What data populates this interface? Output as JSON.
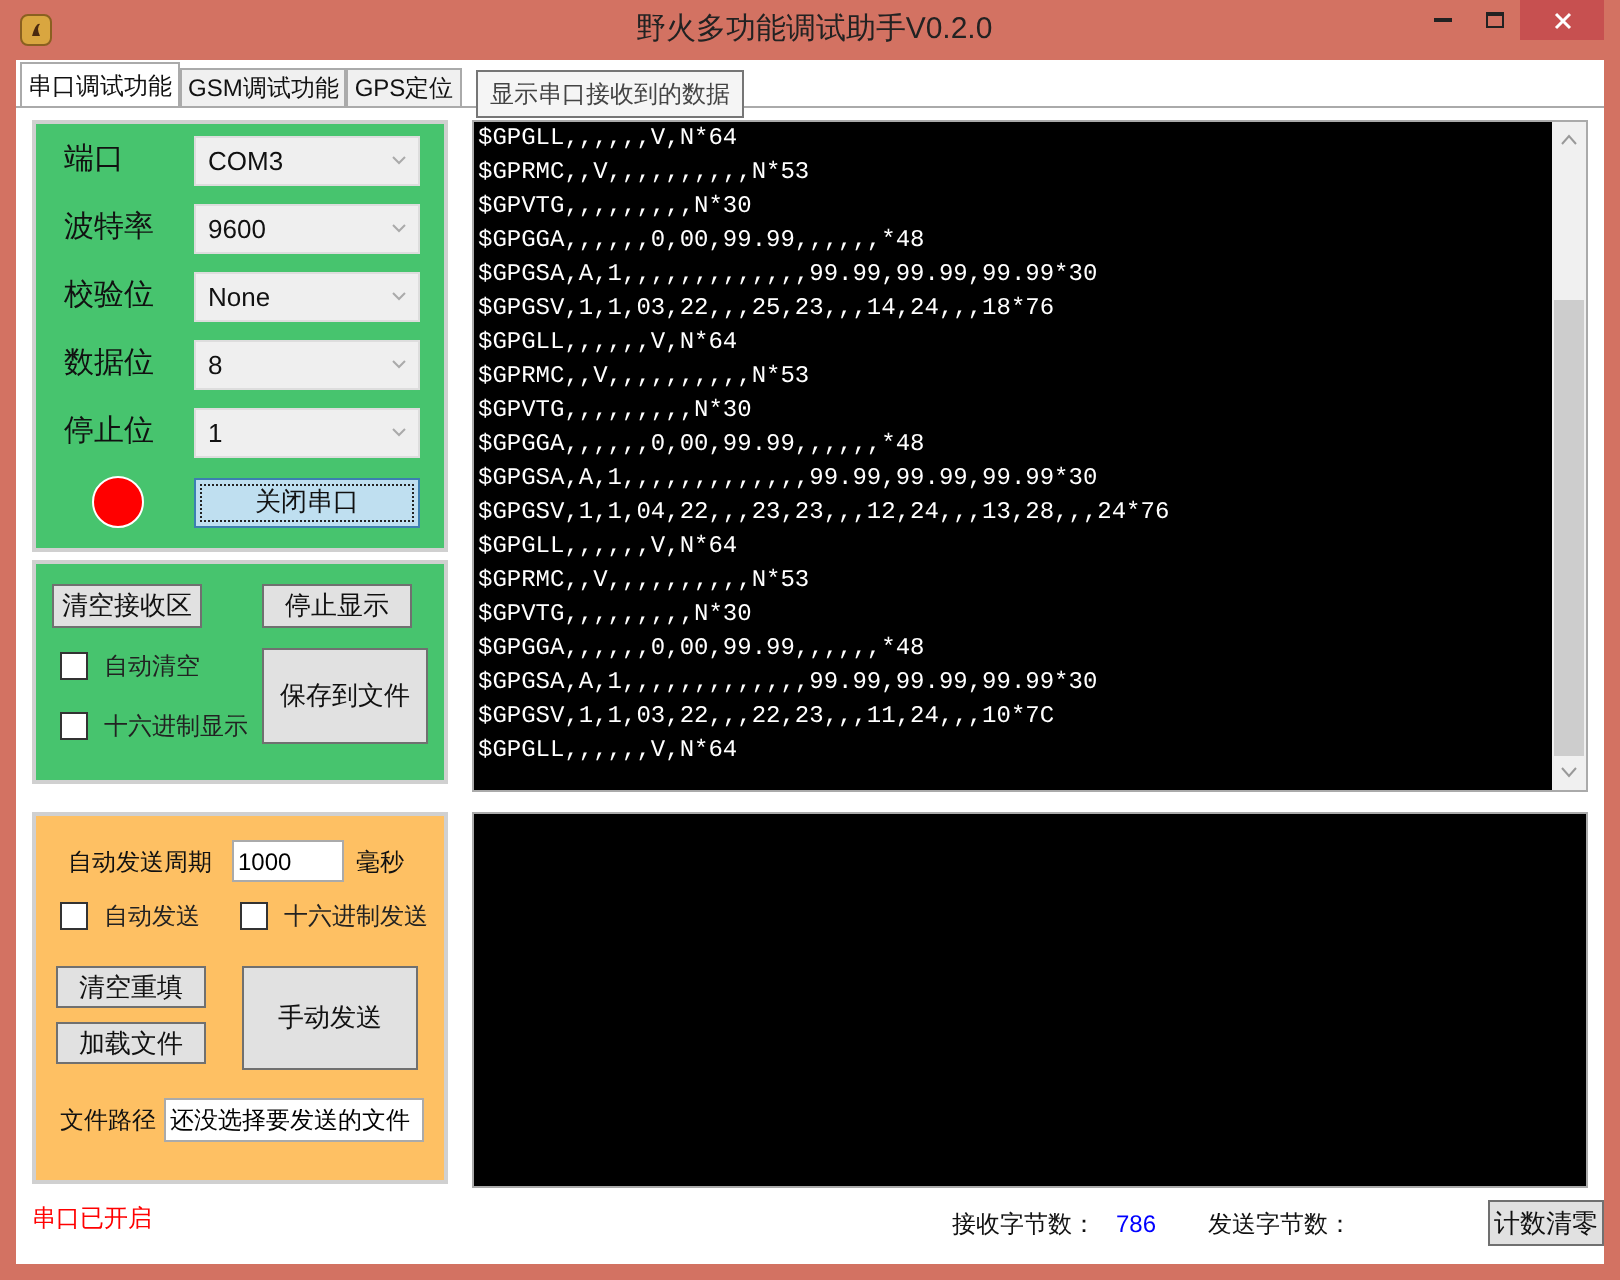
{
  "window": {
    "title": "野火多功能调试助手V0.2.0"
  },
  "tabs": [
    {
      "label": "串口调试功能",
      "selected": true
    },
    {
      "label": "GSM调试功能",
      "selected": false
    },
    {
      "label": "GPS定位",
      "selected": false
    }
  ],
  "tooltip": "显示串口接收到的数据",
  "serial_settings": [
    {
      "label": "端口",
      "value": "COM3"
    },
    {
      "label": "波特率",
      "value": "9600"
    },
    {
      "label": "校验位",
      "value": "None"
    },
    {
      "label": "数据位",
      "value": "8"
    },
    {
      "label": "停止位",
      "value": "1"
    }
  ],
  "port_indicator": {
    "color": "#ff0000"
  },
  "toggle_port_button": "关闭串口",
  "receive_controls": {
    "clear_button": "清空接收区",
    "stop_button": "停止显示",
    "save_button": "保存到文件",
    "checkboxes": [
      {
        "label": "自动清空",
        "checked": false
      },
      {
        "label": "十六进制显示",
        "checked": false
      }
    ]
  },
  "receive_lines": [
    "$GPGLL,,,,,,V,N*64",
    "$GPRMC,,V,,,,,,,,,,N*53",
    "$GPVTG,,,,,,,,,N*30",
    "$GPGGA,,,,,,0,00,99.99,,,,,,*48",
    "$GPGSA,A,1,,,,,,,,,,,,,99.99,99.99,99.99*30",
    "$GPGSV,1,1,03,22,,,25,23,,,14,24,,,18*76",
    "$GPGLL,,,,,,V,N*64",
    "$GPRMC,,V,,,,,,,,,,N*53",
    "$GPVTG,,,,,,,,,N*30",
    "$GPGGA,,,,,,0,00,99.99,,,,,,*48",
    "$GPGSA,A,1,,,,,,,,,,,,,99.99,99.99,99.99*30",
    "$GPGSV,1,1,04,22,,,23,23,,,12,24,,,13,28,,,24*76",
    "$GPGLL,,,,,,V,N*64",
    "$GPRMC,,V,,,,,,,,,,N*53",
    "$GPVTG,,,,,,,,,N*30",
    "$GPGGA,,,,,,0,00,99.99,,,,,,*48",
    "$GPGSA,A,1,,,,,,,,,,,,,99.99,99.99,99.99*30",
    "$GPGSV,1,1,03,22,,,22,23,,,11,24,,,10*7C",
    "$GPGLL,,,,,,V,N*64"
  ],
  "send_controls": {
    "period_label": "自动发送周期",
    "period_value": "1000",
    "period_unit": "毫秒",
    "checkboxes": [
      {
        "label": "自动发送",
        "checked": false
      },
      {
        "label": "十六进制发送",
        "checked": false
      }
    ],
    "clear_button": "清空重填",
    "load_button": "加载文件",
    "send_button": "手动发送",
    "path_label": "文件路径",
    "path_value": "还没选择要发送的文件"
  },
  "status_bar": {
    "port_status": "串口已开启",
    "received_label": "接收字节数：",
    "received_count": "786",
    "sent_label": "发送字节数：",
    "reset_button": "计数清零"
  }
}
